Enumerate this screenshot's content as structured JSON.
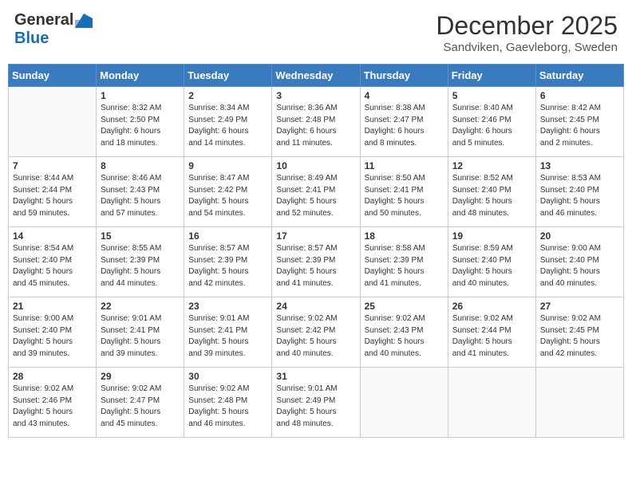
{
  "header": {
    "logo_general": "General",
    "logo_blue": "Blue",
    "month_title": "December 2025",
    "subtitle": "Sandviken, Gaevleborg, Sweden"
  },
  "days_of_week": [
    "Sunday",
    "Monday",
    "Tuesday",
    "Wednesday",
    "Thursday",
    "Friday",
    "Saturday"
  ],
  "weeks": [
    [
      {
        "day": "",
        "info": ""
      },
      {
        "day": "1",
        "info": "Sunrise: 8:32 AM\nSunset: 2:50 PM\nDaylight: 6 hours\nand 18 minutes."
      },
      {
        "day": "2",
        "info": "Sunrise: 8:34 AM\nSunset: 2:49 PM\nDaylight: 6 hours\nand 14 minutes."
      },
      {
        "day": "3",
        "info": "Sunrise: 8:36 AM\nSunset: 2:48 PM\nDaylight: 6 hours\nand 11 minutes."
      },
      {
        "day": "4",
        "info": "Sunrise: 8:38 AM\nSunset: 2:47 PM\nDaylight: 6 hours\nand 8 minutes."
      },
      {
        "day": "5",
        "info": "Sunrise: 8:40 AM\nSunset: 2:46 PM\nDaylight: 6 hours\nand 5 minutes."
      },
      {
        "day": "6",
        "info": "Sunrise: 8:42 AM\nSunset: 2:45 PM\nDaylight: 6 hours\nand 2 minutes."
      }
    ],
    [
      {
        "day": "7",
        "info": "Sunrise: 8:44 AM\nSunset: 2:44 PM\nDaylight: 5 hours\nand 59 minutes."
      },
      {
        "day": "8",
        "info": "Sunrise: 8:46 AM\nSunset: 2:43 PM\nDaylight: 5 hours\nand 57 minutes."
      },
      {
        "day": "9",
        "info": "Sunrise: 8:47 AM\nSunset: 2:42 PM\nDaylight: 5 hours\nand 54 minutes."
      },
      {
        "day": "10",
        "info": "Sunrise: 8:49 AM\nSunset: 2:41 PM\nDaylight: 5 hours\nand 52 minutes."
      },
      {
        "day": "11",
        "info": "Sunrise: 8:50 AM\nSunset: 2:41 PM\nDaylight: 5 hours\nand 50 minutes."
      },
      {
        "day": "12",
        "info": "Sunrise: 8:52 AM\nSunset: 2:40 PM\nDaylight: 5 hours\nand 48 minutes."
      },
      {
        "day": "13",
        "info": "Sunrise: 8:53 AM\nSunset: 2:40 PM\nDaylight: 5 hours\nand 46 minutes."
      }
    ],
    [
      {
        "day": "14",
        "info": "Sunrise: 8:54 AM\nSunset: 2:40 PM\nDaylight: 5 hours\nand 45 minutes."
      },
      {
        "day": "15",
        "info": "Sunrise: 8:55 AM\nSunset: 2:39 PM\nDaylight: 5 hours\nand 44 minutes."
      },
      {
        "day": "16",
        "info": "Sunrise: 8:57 AM\nSunset: 2:39 PM\nDaylight: 5 hours\nand 42 minutes."
      },
      {
        "day": "17",
        "info": "Sunrise: 8:57 AM\nSunset: 2:39 PM\nDaylight: 5 hours\nand 41 minutes."
      },
      {
        "day": "18",
        "info": "Sunrise: 8:58 AM\nSunset: 2:39 PM\nDaylight: 5 hours\nand 41 minutes."
      },
      {
        "day": "19",
        "info": "Sunrise: 8:59 AM\nSunset: 2:40 PM\nDaylight: 5 hours\nand 40 minutes."
      },
      {
        "day": "20",
        "info": "Sunrise: 9:00 AM\nSunset: 2:40 PM\nDaylight: 5 hours\nand 40 minutes."
      }
    ],
    [
      {
        "day": "21",
        "info": "Sunrise: 9:00 AM\nSunset: 2:40 PM\nDaylight: 5 hours\nand 39 minutes."
      },
      {
        "day": "22",
        "info": "Sunrise: 9:01 AM\nSunset: 2:41 PM\nDaylight: 5 hours\nand 39 minutes."
      },
      {
        "day": "23",
        "info": "Sunrise: 9:01 AM\nSunset: 2:41 PM\nDaylight: 5 hours\nand 39 minutes."
      },
      {
        "day": "24",
        "info": "Sunrise: 9:02 AM\nSunset: 2:42 PM\nDaylight: 5 hours\nand 40 minutes."
      },
      {
        "day": "25",
        "info": "Sunrise: 9:02 AM\nSunset: 2:43 PM\nDaylight: 5 hours\nand 40 minutes."
      },
      {
        "day": "26",
        "info": "Sunrise: 9:02 AM\nSunset: 2:44 PM\nDaylight: 5 hours\nand 41 minutes."
      },
      {
        "day": "27",
        "info": "Sunrise: 9:02 AM\nSunset: 2:45 PM\nDaylight: 5 hours\nand 42 minutes."
      }
    ],
    [
      {
        "day": "28",
        "info": "Sunrise: 9:02 AM\nSunset: 2:46 PM\nDaylight: 5 hours\nand 43 minutes."
      },
      {
        "day": "29",
        "info": "Sunrise: 9:02 AM\nSunset: 2:47 PM\nDaylight: 5 hours\nand 45 minutes."
      },
      {
        "day": "30",
        "info": "Sunrise: 9:02 AM\nSunset: 2:48 PM\nDaylight: 5 hours\nand 46 minutes."
      },
      {
        "day": "31",
        "info": "Sunrise: 9:01 AM\nSunset: 2:49 PM\nDaylight: 5 hours\nand 48 minutes."
      },
      {
        "day": "",
        "info": ""
      },
      {
        "day": "",
        "info": ""
      },
      {
        "day": "",
        "info": ""
      }
    ]
  ]
}
